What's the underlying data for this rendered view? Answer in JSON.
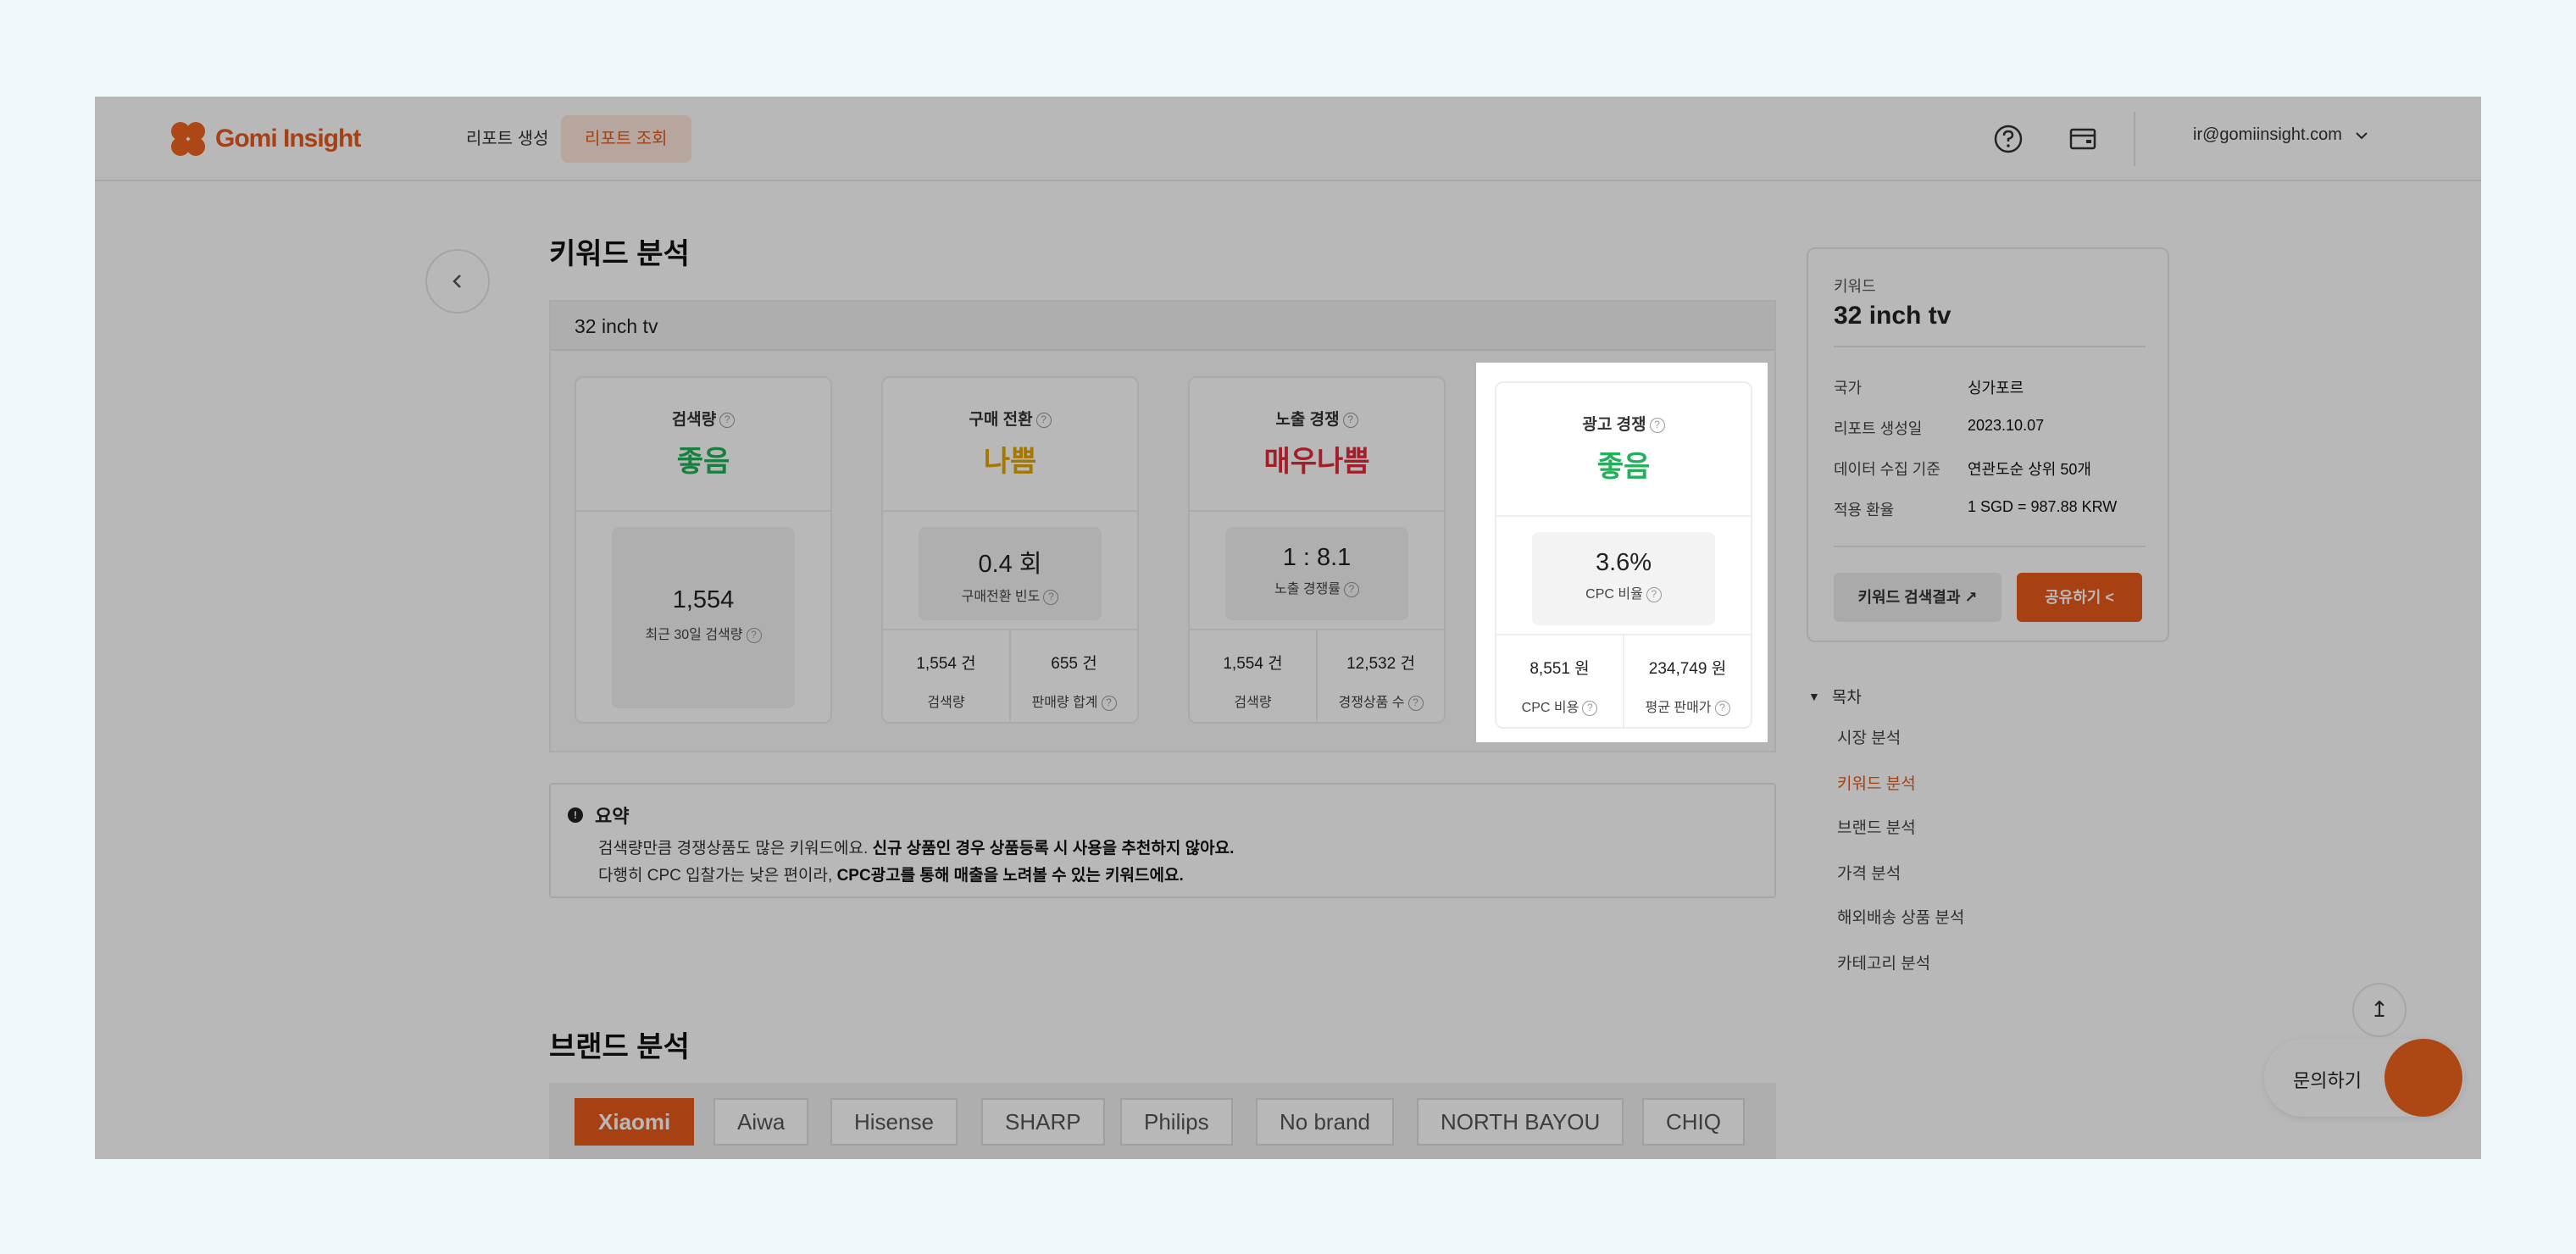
{
  "header": {
    "brand": "Gomi Insight",
    "nav_create": "리포트 생성",
    "nav_view": "리포트 조회",
    "user_email": "ir@gomiinsight.com",
    "accent": "#e8591a"
  },
  "keyword_section": {
    "title": "키워드 분석",
    "keyword": "32 inch tv",
    "cards": [
      {
        "title": "검색량",
        "rating": "좋음",
        "rating_color": "#22b05a",
        "main_value": "1,554",
        "main_label": "최근 30일 검색량"
      },
      {
        "title": "구매 전환",
        "rating": "나쁨",
        "rating_color": "#e6a500",
        "main_value": "0.4 회",
        "main_label": "구매전환 빈도",
        "foot": [
          {
            "value": "1,554 건",
            "label": "검색량"
          },
          {
            "value": "655 건",
            "label": "판매량 합계"
          }
        ]
      },
      {
        "title": "노출 경쟁",
        "rating": "매우나쁨",
        "rating_color": "#e02a3b",
        "main_value": "1 : 8.1",
        "main_label": "노출 경쟁률",
        "foot": [
          {
            "value": "1,554 건",
            "label": "검색량"
          },
          {
            "value": "12,532 건",
            "label": "경쟁상품 수"
          }
        ]
      },
      {
        "title": "광고 경쟁",
        "rating": "좋음",
        "rating_color": "#22b05a",
        "main_value": "3.6%",
        "main_label": "CPC 비율",
        "foot": [
          {
            "value": "8,551 원",
            "label": "CPC 비용"
          },
          {
            "value": "234,749 원",
            "label": "평균 판매가"
          }
        ]
      }
    ]
  },
  "summary": {
    "title": "요약",
    "line1_plain": "검색량만큼 경쟁상품도 많은 키워드에요. ",
    "line1_bold": "신규 상품인 경우 상품등록 시 사용을 추천하지 않아요.",
    "line2_plain": "다행히 CPC 입찰가는 낮은 편이라, ",
    "line2_bold": "CPC광고를 통해 매출을 노려볼 수 있는 키워드에요."
  },
  "brand_section": {
    "title": "브랜드 분석",
    "brands": [
      "Xiaomi",
      "Aiwa",
      "Hisense",
      "SHARP",
      "Philips",
      "No brand",
      "NORTH BAYOU",
      "CHIQ"
    ],
    "active": "Xiaomi"
  },
  "info_card": {
    "keyword_label": "키워드",
    "keyword_value": "32 inch tv",
    "rows": [
      {
        "label": "국가",
        "value": "싱가포르"
      },
      {
        "label": "리포트 생성일",
        "value": "2023.10.07"
      },
      {
        "label": "데이터 수집 기준",
        "value": "연관도순 상위 50개"
      },
      {
        "label": "적용 환율",
        "value": "1 SGD = 987.88 KRW"
      }
    ],
    "search_button": "키워드 검색결과",
    "share_button": "공유하기"
  },
  "toc": {
    "title": "목차",
    "items": [
      "시장 분석",
      "키워드 분석",
      "브랜드 분석",
      "가격 분석",
      "해외배송 상품 분석",
      "카테고리 분석"
    ],
    "active": "키워드 분석"
  },
  "floating": {
    "inquiry": "문의하기"
  }
}
